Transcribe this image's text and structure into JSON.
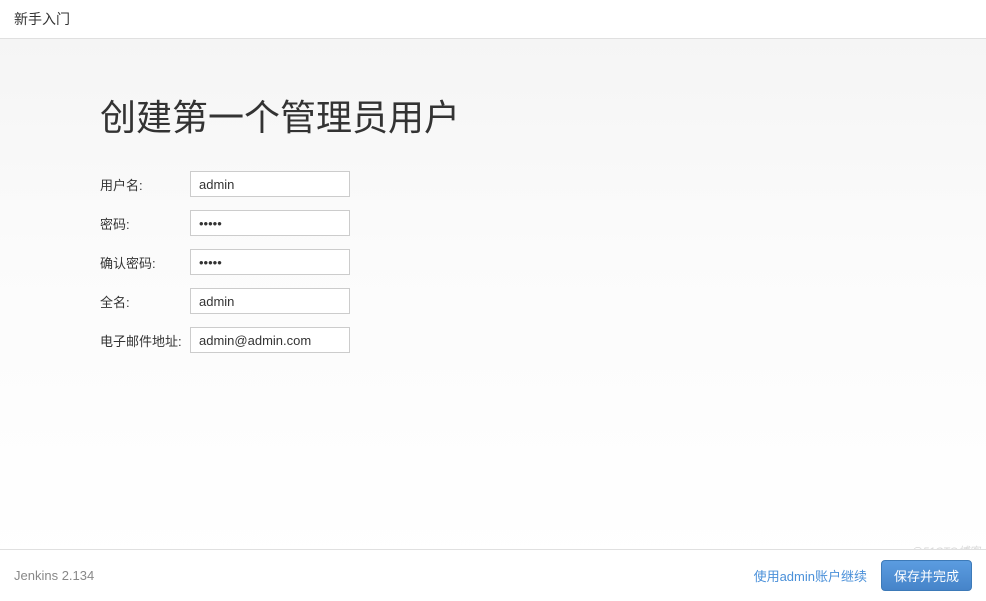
{
  "header": {
    "title": "新手入门"
  },
  "main": {
    "title": "创建第一个管理员用户",
    "fields": {
      "username": {
        "label": "用户名:",
        "value": "admin"
      },
      "password": {
        "label": "密码:",
        "value": "•••••"
      },
      "confirm_password": {
        "label": "确认密码:",
        "value": "•••••"
      },
      "fullname": {
        "label": "全名:",
        "value": "admin"
      },
      "email": {
        "label": "电子邮件地址:",
        "value": "admin@admin.com"
      }
    }
  },
  "footer": {
    "version": "Jenkins 2.134",
    "continue_as_admin": "使用admin账户继续",
    "save_and_finish": "保存并完成"
  },
  "watermark": "@51CTO博客"
}
